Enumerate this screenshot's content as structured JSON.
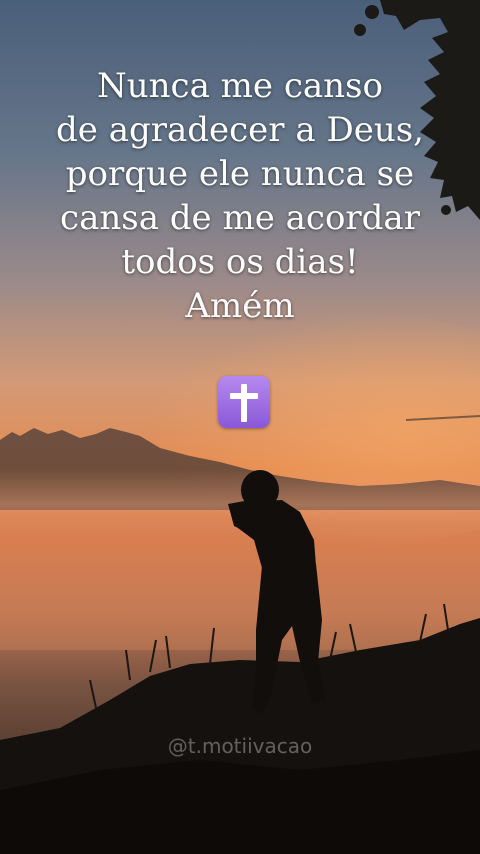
{
  "quote": {
    "lines": [
      "Nunca me canso",
      "de agradecer a Deus,",
      "porque ele nunca se",
      "cansa de me acordar",
      "todos os dias!",
      "Amém"
    ]
  },
  "emoji": {
    "icon": "latin-cross-icon",
    "color": "#9b6ee0"
  },
  "watermark": {
    "handle": "@t.motiivacao"
  },
  "colors": {
    "sky_top": "#4a5f7a",
    "horizon": "#e58a4f",
    "ground": "#120f0c"
  }
}
